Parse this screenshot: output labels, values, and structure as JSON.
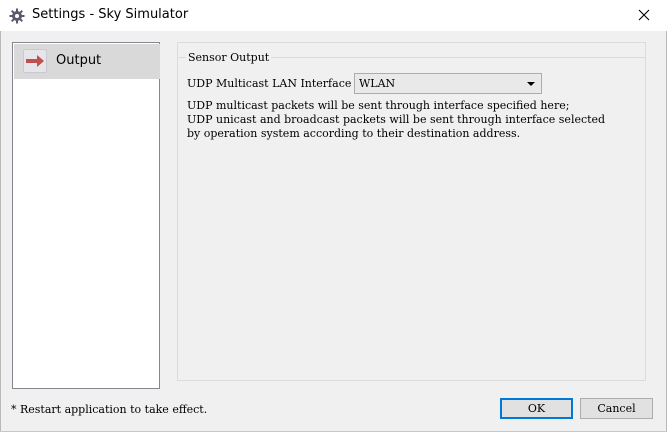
{
  "window": {
    "title": "Settings - Sky Simulator",
    "icon": "gear-icon",
    "close_glyph": "✕"
  },
  "nav": {
    "items": [
      {
        "label": "Output",
        "icon": "arrow-right-icon",
        "selected": true
      }
    ]
  },
  "sensor_output": {
    "group_title": "Sensor Output",
    "interface_label": "UDP Multicast LAN Interface",
    "interface_value": "WLAN",
    "description_lines": [
      "UDP multicast packets will be sent through interface specified here;",
      "UDP unicast and broadcast packets will be sent through interface selected",
      "by operation system according to their destination address."
    ]
  },
  "footer": {
    "note": "* Restart application to take effect.",
    "ok_label": "OK",
    "cancel_label": "Cancel"
  },
  "colors": {
    "accent": "#0078d7",
    "nav_selected_bg": "#d9d9d9",
    "arrow_red": "#c0504d"
  }
}
